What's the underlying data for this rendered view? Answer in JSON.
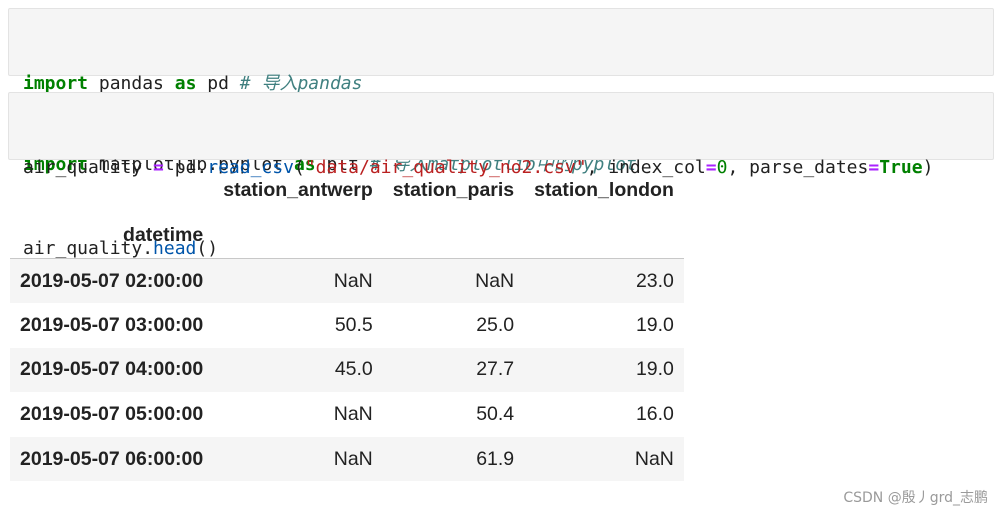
{
  "cells": [
    {
      "lines": [
        [
          {
            "t": "import",
            "c": "kw"
          },
          {
            "t": " pandas ",
            "c": ""
          },
          {
            "t": "as",
            "c": "kw"
          },
          {
            "t": " pd ",
            "c": ""
          },
          {
            "t": "# 导入pandas",
            "c": "cm"
          }
        ],
        [
          {
            "t": "import",
            "c": "kw"
          },
          {
            "t": " matplotlib.pyplot ",
            "c": ""
          },
          {
            "t": "as",
            "c": "kw"
          },
          {
            "t": " plt ",
            "c": ""
          },
          {
            "t": "# 导入matplotlib中的pyplot",
            "c": "cm"
          }
        ]
      ]
    },
    {
      "lines": [
        [
          {
            "t": "air_quality ",
            "c": ""
          },
          {
            "t": "=",
            "c": "op"
          },
          {
            "t": " pd.",
            "c": ""
          },
          {
            "t": "read_csv",
            "c": "fn"
          },
          {
            "t": "(",
            "c": ""
          },
          {
            "t": "\"data/air_quality_no2.csv\"",
            "c": "st"
          },
          {
            "t": ", index_col",
            "c": ""
          },
          {
            "t": "=",
            "c": "op"
          },
          {
            "t": "0",
            "c": "nm"
          },
          {
            "t": ", parse_dates",
            "c": ""
          },
          {
            "t": "=",
            "c": "op"
          },
          {
            "t": "True",
            "c": "bool"
          },
          {
            "t": ")",
            "c": ""
          }
        ],
        [
          {
            "t": "air_quality.",
            "c": ""
          },
          {
            "t": "head",
            "c": "fn"
          },
          {
            "t": "()",
            "c": ""
          }
        ]
      ]
    }
  ],
  "dataframe": {
    "columns": [
      "station_antwerp",
      "station_paris",
      "station_london"
    ],
    "index_name": "datetime",
    "rows": [
      {
        "index": "2019-05-07 02:00:00",
        "values": [
          "NaN",
          "NaN",
          "23.0"
        ]
      },
      {
        "index": "2019-05-07 03:00:00",
        "values": [
          "50.5",
          "25.0",
          "19.0"
        ]
      },
      {
        "index": "2019-05-07 04:00:00",
        "values": [
          "45.0",
          "27.7",
          "19.0"
        ]
      },
      {
        "index": "2019-05-07 05:00:00",
        "values": [
          "NaN",
          "50.4",
          "16.0"
        ]
      },
      {
        "index": "2019-05-07 06:00:00",
        "values": [
          "NaN",
          "61.9",
          "NaN"
        ]
      }
    ]
  },
  "watermark": "CSDN @殷丿grd_志鹏",
  "colors": {
    "keyword": "#008000",
    "operator": "#aa22ff",
    "comment": "#408080",
    "function": "#0055aa",
    "string": "#ba2121",
    "cell_background": "#f5f5f5"
  }
}
